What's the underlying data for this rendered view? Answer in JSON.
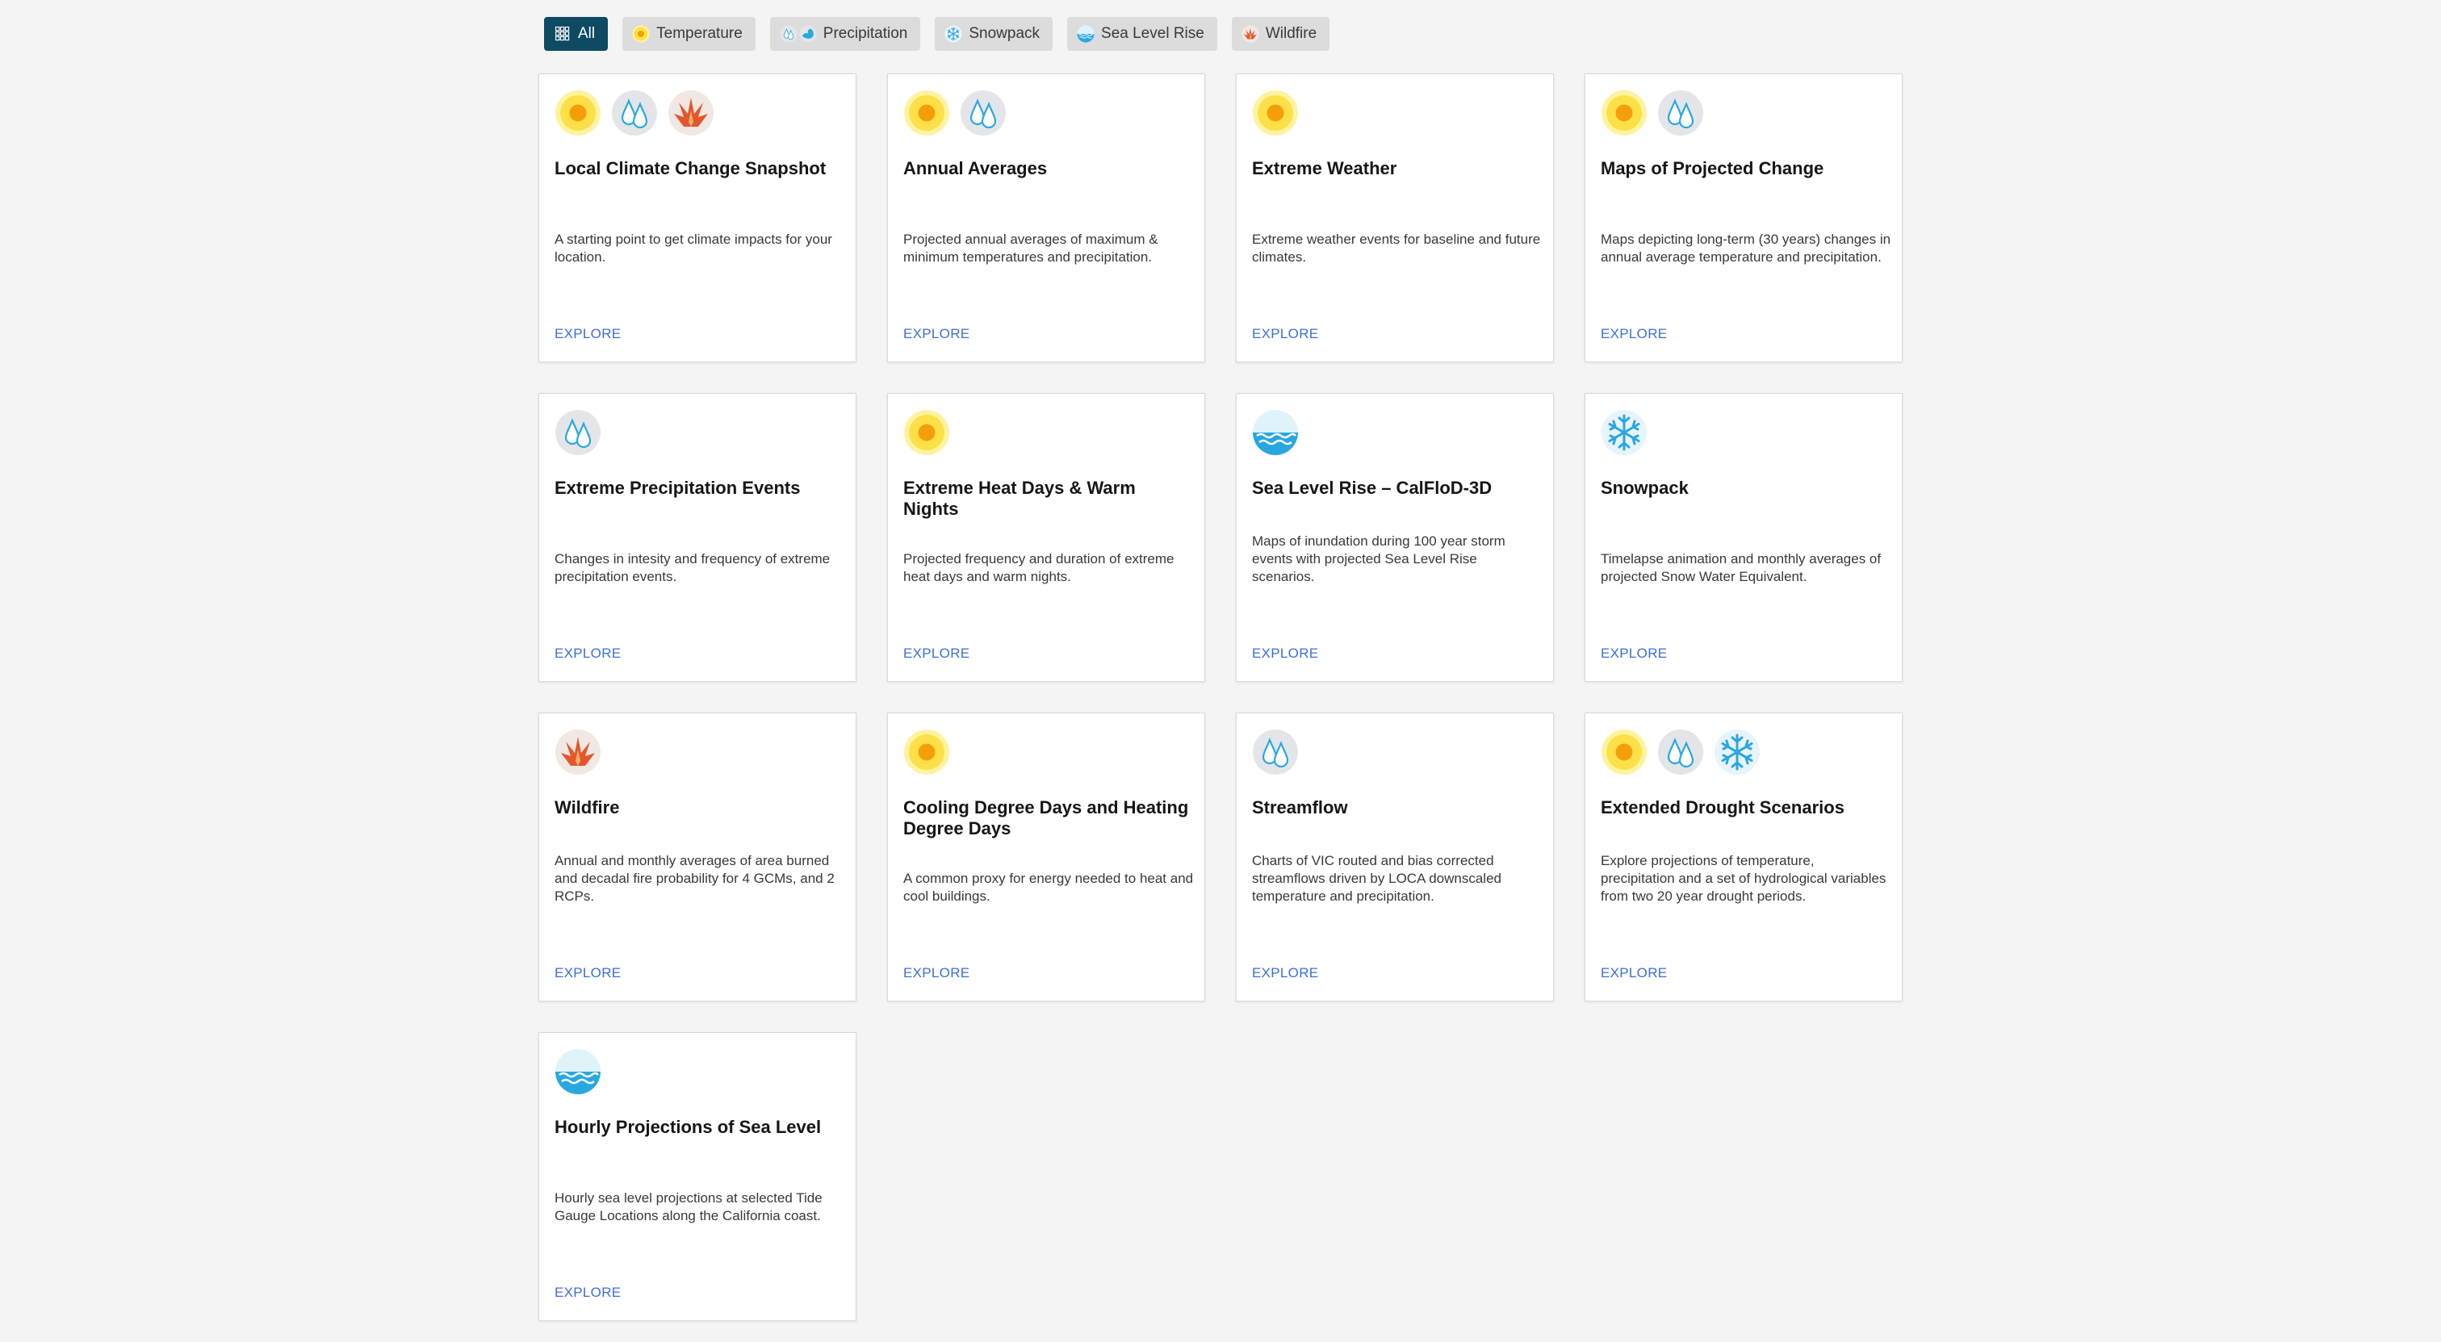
{
  "filters": [
    {
      "label": "All",
      "icons": [
        "grid-icon"
      ],
      "active": true
    },
    {
      "label": "Temperature",
      "icons": [
        "sun-icon"
      ],
      "active": false
    },
    {
      "label": "Precipitation",
      "icons": [
        "raindrops-icon",
        "wave-icon"
      ],
      "active": false
    },
    {
      "label": "Snowpack",
      "icons": [
        "snowflake-icon"
      ],
      "active": false
    },
    {
      "label": "Sea Level Rise",
      "icons": [
        "sea-level-icon"
      ],
      "active": false
    },
    {
      "label": "Wildfire",
      "icons": [
        "fire-icon"
      ],
      "active": false
    }
  ],
  "colors": {
    "active_chip": "#0f4a63",
    "link": "#3d6fd6",
    "sun": "#fde047",
    "fire": "#e4572e",
    "water": "#29a8e0"
  },
  "cards": [
    {
      "title": "Local Climate Change Snapshot",
      "desc": "A starting point to get climate impacts for your location.",
      "link": "EXPLORE",
      "icons": [
        "sun-icon",
        "raindrops-icon",
        "fire-icon"
      ]
    },
    {
      "title": "Annual Averages",
      "desc": "Projected annual averages of maximum & minimum temperatures and precipitation.",
      "link": "EXPLORE",
      "icons": [
        "sun-icon",
        "raindrops-icon"
      ]
    },
    {
      "title": "Extreme Weather",
      "desc": "Extreme weather events for baseline and future climates.",
      "link": "EXPLORE",
      "icons": [
        "sun-icon"
      ]
    },
    {
      "title": "Maps of Projected Change",
      "desc": "Maps depicting long-term (30 years) changes in annual average temperature and precipitation.",
      "link": "EXPLORE",
      "icons": [
        "sun-icon",
        "raindrops-icon"
      ]
    },
    {
      "title": "Extreme Precipitation Events",
      "desc": "Changes in intesity and frequency of extreme precipitation events.",
      "link": "EXPLORE",
      "icons": [
        "raindrops-icon"
      ]
    },
    {
      "title": "Extreme Heat Days & Warm Nights",
      "desc": "Projected frequency and duration of extreme heat days and warm nights.",
      "link": "EXPLORE",
      "icons": [
        "sun-icon"
      ]
    },
    {
      "title": "Sea Level Rise – CalFloD-3D",
      "desc": "Maps of inundation during 100 year storm events with projected Sea Level Rise scenarios.",
      "link": "EXPLORE",
      "icons": [
        "sea-level-icon"
      ]
    },
    {
      "title": "Snowpack",
      "desc": "Timelapse animation and monthly averages of projected Snow Water Equivalent.",
      "link": "EXPLORE",
      "icons": [
        "snowflake-icon"
      ]
    },
    {
      "title": "Wildfire",
      "desc": "Annual and monthly averages of area burned and decadal fire probability for 4 GCMs, and 2 RCPs.",
      "link": "EXPLORE",
      "icons": [
        "fire-icon"
      ]
    },
    {
      "title": "Cooling Degree Days and Heating Degree Days",
      "desc": "A common proxy for energy needed to heat and cool buildings.",
      "link": "EXPLORE",
      "icons": [
        "sun-icon"
      ]
    },
    {
      "title": "Streamflow",
      "desc": "Charts of VIC routed and bias corrected streamflows driven by LOCA downscaled temperature and precipitation.",
      "link": "EXPLORE",
      "icons": [
        "raindrops-icon"
      ]
    },
    {
      "title": "Extended Drought Scenarios",
      "desc": "Explore projections of temperature, precipitation and a set of hydrological variables from two 20 year drought periods.",
      "link": "EXPLORE",
      "icons": [
        "sun-icon",
        "raindrops-icon",
        "snowflake-icon"
      ]
    },
    {
      "title": "Hourly Projections of Sea Level",
      "desc": "Hourly sea level projections at selected Tide Gauge Locations along the California coast.",
      "link": "EXPLORE",
      "icons": [
        "sea-level-icon"
      ]
    }
  ]
}
